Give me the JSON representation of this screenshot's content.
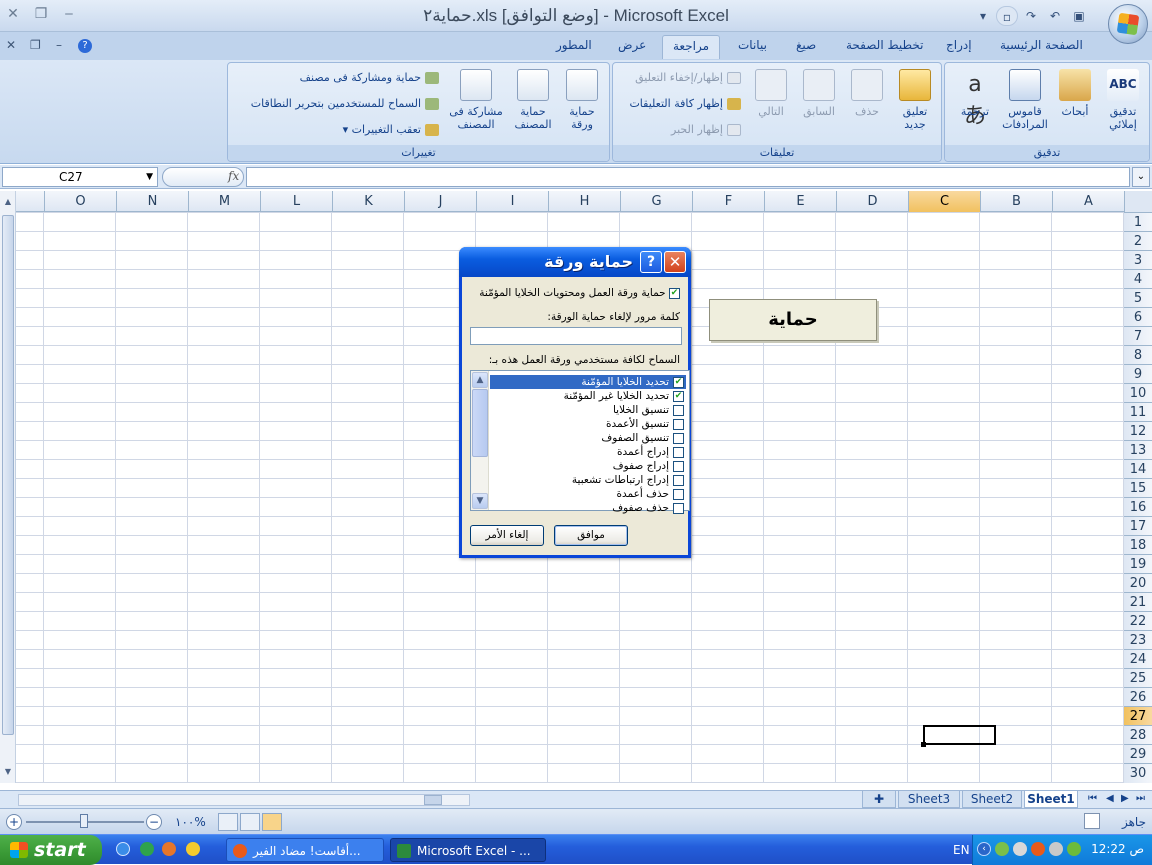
{
  "window": {
    "title": "حماية٢.xls  [وضع التوافق] - Microsoft Excel"
  },
  "tabs": [
    "الصفحة الرئيسية",
    "إدراج",
    "تخطيط الصفحة",
    "صيغ",
    "بيانات",
    "مراجعة",
    "عرض",
    "المطور"
  ],
  "active_tab": "مراجعة",
  "ribbon": {
    "proofing": {
      "title": "تدقيق",
      "spelling": "تدقيق إملائي",
      "research": "أبحاث",
      "thesaurus": "قاموس المرادفات",
      "translate": "ترجمة"
    },
    "comments": {
      "title": "تعليقات",
      "new": "تعليق جديد",
      "delete": "حذف",
      "previous": "السابق",
      "next": "التالي",
      "show_hide": "إظهار/إخفاء التعليق",
      "show_all": "إظهار كافة التعليقات",
      "show_ink": "إظهار الحبر"
    },
    "changes": {
      "title": "تغييرات",
      "protect_sheet": "حماية ورقة",
      "protect_workbook": "حماية المصنف",
      "share_workbook": "مشاركة فى المصنف",
      "protect_share": "حماية ومشاركة فى مصنف",
      "allow_edit": "السماح للمستخدمين بتحرير النطاقات",
      "track_changes": "تعقب التغييرات"
    }
  },
  "formula_bar": {
    "name_box": "C27",
    "fx": "fx",
    "formula": ""
  },
  "grid": {
    "columns": [
      "A",
      "B",
      "C",
      "D",
      "E",
      "F",
      "G",
      "H",
      "I",
      "J",
      "K",
      "L",
      "M",
      "N",
      "O"
    ],
    "selected_column": "C",
    "rows": [
      "1",
      "2",
      "3",
      "4",
      "5",
      "6",
      "7",
      "8",
      "9",
      "10",
      "11",
      "12",
      "13",
      "14",
      "15",
      "16",
      "17",
      "18",
      "19",
      "20",
      "21",
      "22",
      "23",
      "24",
      "25",
      "26",
      "27",
      "28",
      "29",
      "30"
    ],
    "selected_row": "27",
    "shape_text": "حماية"
  },
  "sheets": [
    "Sheet1",
    "Sheet2",
    "Sheet3"
  ],
  "active_sheet": "Sheet1",
  "status": {
    "ready": "جاهز",
    "zoom": "١٠٠%"
  },
  "dialog": {
    "title": "حماية ورقة",
    "help": "?",
    "protect_checkbox_label": "حماية ورقة العمل ومحتويات الخلايا المؤمّنة",
    "password_label": "كلمة مرور لإلغاء حماية الورقة:",
    "allow_label": "السماح لكافة مستخدمي ورقة العمل هذه بـ:",
    "permissions": [
      {
        "label": "تحديد الخلايا المؤمّنة",
        "checked": true
      },
      {
        "label": "تحديد الخلايا غير المؤمّنة",
        "checked": true
      },
      {
        "label": "تنسيق الخلايا",
        "checked": false
      },
      {
        "label": "تنسيق الأعمدة",
        "checked": false
      },
      {
        "label": "تنسيق الصفوف",
        "checked": false
      },
      {
        "label": "إدراج أعمدة",
        "checked": false
      },
      {
        "label": "إدراج صفوف",
        "checked": false
      },
      {
        "label": "إدراج ارتباطات تشعبية",
        "checked": false
      },
      {
        "label": "حذف أعمدة",
        "checked": false
      },
      {
        "label": "حذف صفوف",
        "checked": false
      }
    ],
    "ok": "موافق",
    "cancel": "إلغاء الأمر"
  },
  "taskbar": {
    "start": "start",
    "buttons": [
      "أفاست! مضاد الفير...",
      "Microsoft Excel - ..."
    ],
    "lang": "EN",
    "clock": "12:22 ص"
  }
}
